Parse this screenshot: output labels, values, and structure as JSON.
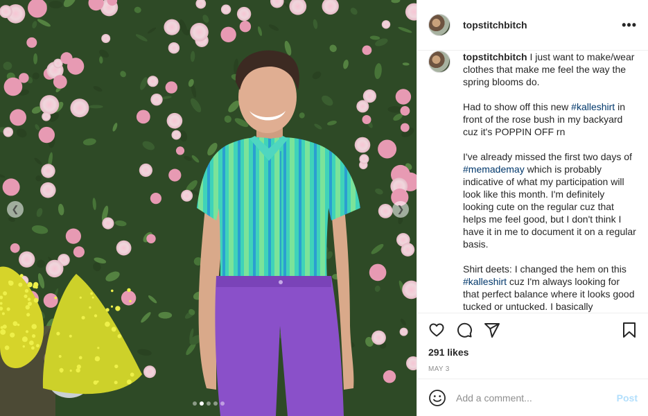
{
  "post": {
    "username": "topstitchbitch",
    "more_label": "•••",
    "avatar_icon": "profile-avatar",
    "caption": {
      "username": "topstitchbitch",
      "paragraphs": [
        [
          {
            "t": "I just want to make/wear clothes that make me feel the way the spring blooms do."
          }
        ],
        [
          {
            "t": "Had to show off this new "
          },
          {
            "t": "#kalleshirt",
            "tag": true
          },
          {
            "t": " in front of the rose bush in my backyard cuz it's POPPIN OFF rn"
          }
        ],
        [
          {
            "t": "I've already missed the first two days of "
          },
          {
            "t": "#memademay",
            "tag": true
          },
          {
            "t": " which is probably indicative of what my participation will look like this month. I'm definitely looking cute on the regular cuz that helps me feel good, but I don't think I have it in me to document it on a regular basis."
          }
        ],
        [
          {
            "t": "Shirt deets: I changed the hem on this "
          },
          {
            "t": "#kalleshirt",
            "tag": true
          },
          {
            "t": " cuz I'm always looking for that perfect balance where it looks good tucked or untucked. I basically"
          }
        ]
      ]
    },
    "likes": "291 likes",
    "date": "MAY 3",
    "comment_placeholder": "Add a comment...",
    "post_label": "Post",
    "carousel": {
      "total": 5,
      "active_index": 1
    },
    "colors": {
      "link": "#00376b",
      "post_disabled": "#b2dffc",
      "muted": "#8e8e8e"
    },
    "icons": [
      "heart-icon",
      "comment-icon",
      "share-icon",
      "bookmark-icon",
      "emoji-icon",
      "chevron-left-icon",
      "chevron-right-icon"
    ]
  }
}
